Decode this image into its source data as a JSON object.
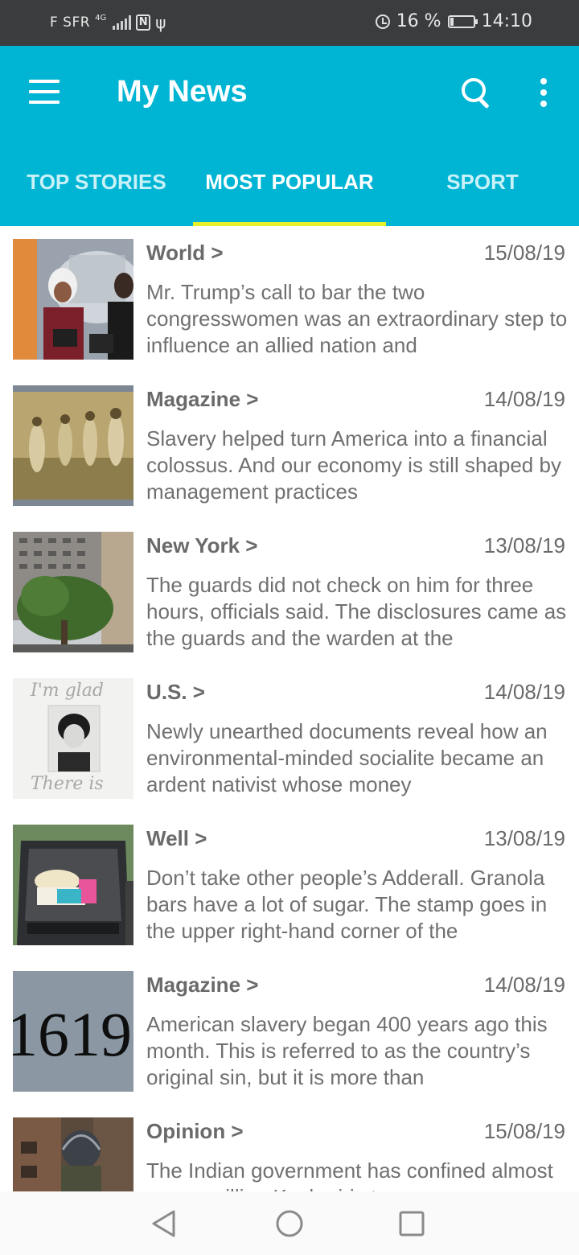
{
  "status_bar": {
    "carrier": "F SFR",
    "network": "4G",
    "battery": "16 %",
    "time": "14:10"
  },
  "app_bar": {
    "title": "My News"
  },
  "tabs": [
    {
      "label": "TOP STORIES",
      "active": false
    },
    {
      "label": "MOST POPULAR",
      "active": true
    },
    {
      "label": "SPORT",
      "active": false
    }
  ],
  "articles": [
    {
      "section": "World >",
      "date": "15/08/19",
      "abstract": "Mr. Trump’s call to bar the two congresswomen was an extraordinary step to influence an allied nation and"
    },
    {
      "section": "Magazine >",
      "date": "14/08/19",
      "abstract": "Slavery helped turn America into a financial colossus. And our economy is still shaped by management practices"
    },
    {
      "section": "New York >",
      "date": "13/08/19",
      "abstract": "The guards did not check on him for three hours, officials said. The disclosures came as the guards and the warden at the"
    },
    {
      "section": "U.S. >",
      "date": "14/08/19",
      "abstract": "Newly unearthed documents reveal how an environmental-minded socialite became an ardent nativist whose money"
    },
    {
      "section": "Well >",
      "date": "13/08/19",
      "abstract": "Don’t take other people’s Adderall. Granola bars have a lot of sugar. The stamp goes in the upper right-hand corner of the"
    },
    {
      "section": "Magazine >",
      "date": "14/08/19",
      "abstract": "American slavery began 400 years ago this month. This is referred to as the country’s original sin, but it is more than"
    },
    {
      "section": "Opinion >",
      "date": "15/08/19",
      "abstract": "The Indian government has confined almost seven million Kashmiris to"
    }
  ],
  "thumb_text": {
    "letter_top": "I'm glad",
    "letter_bottom": "There is",
    "number": "1619"
  },
  "colors": {
    "accent": "#00b5d4",
    "indicator": "#e6f12a",
    "text": "#6a6a6a"
  }
}
